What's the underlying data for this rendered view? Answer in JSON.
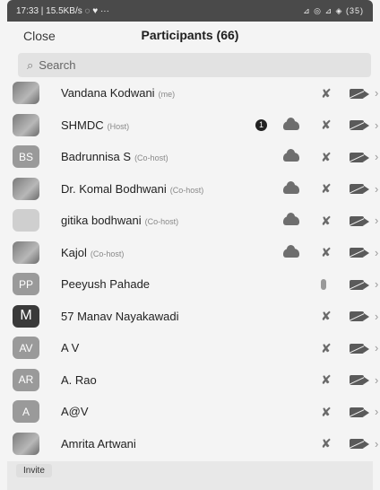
{
  "status_bar": {
    "left": "17:33 | 15.5KB/s ◌ ♥ ···",
    "right": "⊿ ◎ ⊿ ◈ (35)"
  },
  "header": {
    "close_label": "Close",
    "title": "Participants (66)"
  },
  "search": {
    "placeholder": "Search"
  },
  "participants": [
    {
      "name": "Vandana Kodwani",
      "role": "(me)",
      "avatar": "",
      "avatar_style": "photo",
      "cloud": false,
      "badge": "",
      "mic": "muted",
      "cam": "off"
    },
    {
      "name": "SHMDC",
      "role": "(Host)",
      "avatar": "",
      "avatar_style": "photo",
      "cloud": true,
      "badge": "1",
      "mic": "muted",
      "cam": "off"
    },
    {
      "name": "Badrunnisa S",
      "role": "(Co-host)",
      "avatar": "BS",
      "avatar_style": "initials",
      "cloud": true,
      "badge": "",
      "mic": "muted",
      "cam": "off"
    },
    {
      "name": "Dr. Komal Bodhwani",
      "role": "(Co-host)",
      "avatar": "",
      "avatar_style": "photo",
      "cloud": true,
      "badge": "",
      "mic": "muted",
      "cam": "off"
    },
    {
      "name": "gitika bodhwani",
      "role": "(Co-host)",
      "avatar": "",
      "avatar_style": "light",
      "cloud": true,
      "badge": "",
      "mic": "muted",
      "cam": "off"
    },
    {
      "name": "Kajol",
      "role": "(Co-host)",
      "avatar": "",
      "avatar_style": "photo",
      "cloud": true,
      "badge": "",
      "mic": "muted",
      "cam": "off"
    },
    {
      "name": "Peeyush Pahade",
      "role": "",
      "avatar": "PP",
      "avatar_style": "initials",
      "cloud": false,
      "badge": "",
      "mic": "on",
      "cam": "off"
    },
    {
      "name": "57 Manav Nayakawadi",
      "role": "",
      "avatar": "M",
      "avatar_style": "dark",
      "cloud": false,
      "badge": "",
      "mic": "muted",
      "cam": "off"
    },
    {
      "name": "A V",
      "role": "",
      "avatar": "AV",
      "avatar_style": "initials",
      "cloud": false,
      "badge": "",
      "mic": "muted",
      "cam": "off"
    },
    {
      "name": "A. Rao",
      "role": "",
      "avatar": "AR",
      "avatar_style": "initials",
      "cloud": false,
      "badge": "",
      "mic": "muted",
      "cam": "off"
    },
    {
      "name": "A@V",
      "role": "",
      "avatar": "A",
      "avatar_style": "initials",
      "cloud": false,
      "badge": "",
      "mic": "muted",
      "cam": "off"
    },
    {
      "name": "Amrita Artwani",
      "role": "",
      "avatar": "",
      "avatar_style": "photo",
      "cloud": false,
      "badge": "",
      "mic": "muted",
      "cam": "off"
    }
  ],
  "footer": {
    "invite_label": "Invite"
  }
}
